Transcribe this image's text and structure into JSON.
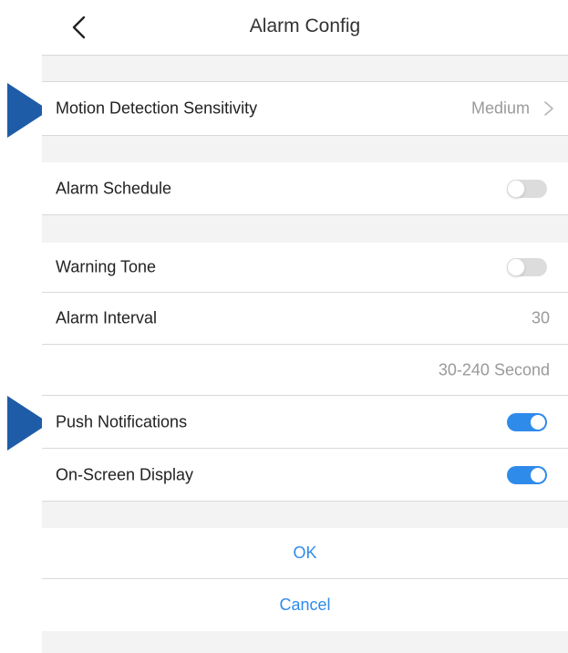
{
  "header": {
    "title": "Alarm Config",
    "back_icon": "chevron-left-icon"
  },
  "settings": {
    "motion_sensitivity": {
      "label": "Motion Detection Sensitivity",
      "value": "Medium"
    },
    "alarm_schedule": {
      "label": "Alarm Schedule",
      "enabled": false
    },
    "warning_tone": {
      "label": "Warning Tone",
      "enabled": false
    },
    "alarm_interval": {
      "label": "Alarm Interval",
      "value": "30",
      "range_hint": "30-240 Second"
    },
    "push_notifications": {
      "label": "Push Notifications",
      "enabled": true
    },
    "on_screen_display": {
      "label": "On-Screen Display",
      "enabled": true
    }
  },
  "actions": {
    "ok_label": "OK",
    "cancel_label": "Cancel"
  },
  "colors": {
    "accent": "#2f8bea",
    "pointer": "#1f5ca8",
    "toggle_off": "#dcdcdc"
  }
}
